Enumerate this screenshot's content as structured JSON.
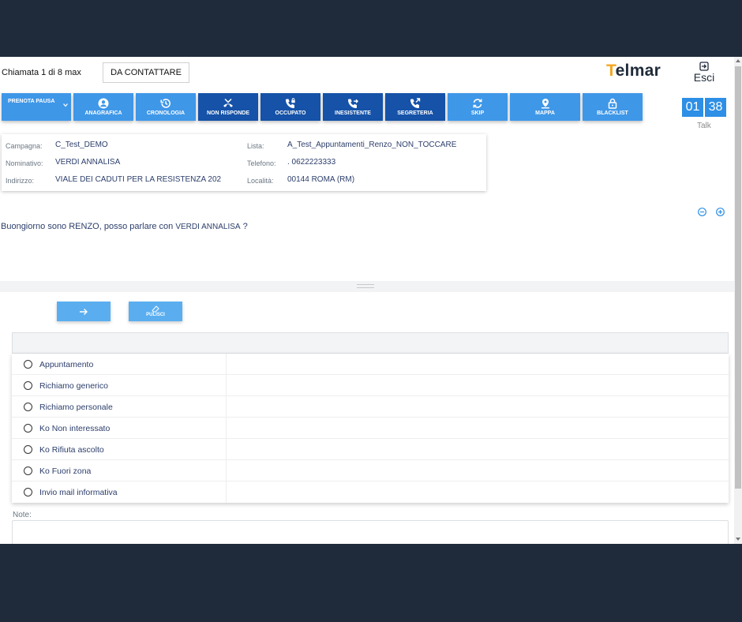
{
  "header": {
    "call_info": "Chiamata 1 di 8 max",
    "status_button": "DA CONTATTARE",
    "logo": "Telmar",
    "exit_label": "Esci"
  },
  "toolbar": {
    "pause_label": "PRENOTA PAUSA",
    "buttons": [
      {
        "label": "ANAGRAFICA",
        "icon": "user-circle-icon",
        "style": "light"
      },
      {
        "label": "CRONOLOGIA",
        "icon": "history-icon",
        "style": "light"
      },
      {
        "label": "NON RISPONDE",
        "icon": "phone-missed-icon",
        "style": "dark"
      },
      {
        "label": "OCCUPATO",
        "icon": "phone-lock-icon",
        "style": "dark"
      },
      {
        "label": "INESISTENTE",
        "icon": "phone-forward-icon",
        "style": "dark"
      },
      {
        "label": "SEGRETERIA",
        "icon": "voicemail-icon",
        "style": "dark"
      },
      {
        "label": "SKIP",
        "icon": "sync-icon",
        "style": "light"
      },
      {
        "label": "MAPPA",
        "icon": "map-pin-icon",
        "style": "light"
      },
      {
        "label": "BLACKLIST",
        "icon": "lock-icon",
        "style": "light"
      }
    ],
    "timer_min": "01",
    "timer_sec": "38",
    "timer_label": "Talk"
  },
  "info": {
    "campagna_label": "Campagna:",
    "campagna": "C_Test_DEMO",
    "nominativo_label": "Nominativo:",
    "nominativo": "VERDI ANNALISA",
    "indirizzo_label": "Indirizzo:",
    "indirizzo": "VIALE DEI CADUTI PER LA RESISTENZA 202",
    "lista_label": "Lista:",
    "lista": "A_Test_Appuntamenti_Renzo_NON_TOCCARE",
    "telefono_label": "Telefono:",
    "telefono": ". 0622223333",
    "localita_label": "Località:",
    "localita": "00144 ROMA (RM)"
  },
  "script": {
    "prefix": "Buongiorno sono RENZO, posso parlare con ",
    "name": "VERDI ANNALISA",
    "suffix": " ?"
  },
  "actions": {
    "clear_label": "PULISCI"
  },
  "options": [
    "Appuntamento",
    "Richiamo generico",
    "Richiamo personale",
    "Ko Non interessato",
    "Ko Rifiuta ascolto",
    "Ko Fuori zona",
    "Invio mail informativa"
  ],
  "note": {
    "label": "Note:",
    "value": ""
  },
  "colors": {
    "light_button": "#3f97e8",
    "dark_button": "#1552a8",
    "accent": "#f5a623",
    "background": "#1f2b3a"
  }
}
